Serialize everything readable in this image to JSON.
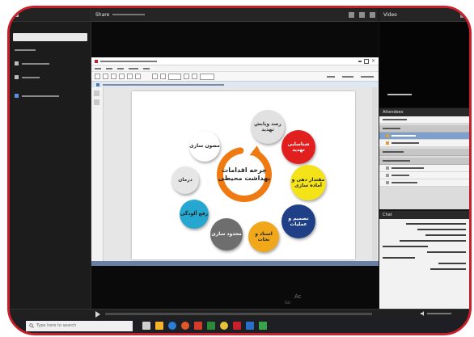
{
  "share_pod": {
    "title": "Share"
  },
  "video_pod": {
    "title": "Video"
  },
  "attendees_pod": {
    "title": "Attendees",
    "sections": [
      {
        "label": ""
      },
      {
        "label": ""
      },
      {
        "label": ""
      }
    ]
  },
  "chat_pod": {
    "title": "Chat"
  },
  "left_panel": {
    "items": [
      {
        "label": ""
      },
      {
        "label": ""
      },
      {
        "label": ""
      }
    ]
  },
  "diagram": {
    "center": "چرخه اقدامات بهداشت محیطی",
    "bubbles": [
      {
        "label": "رصد ویابش تهدید",
        "color": "#e1e1e1",
        "text_color": "#333333"
      },
      {
        "label": "شناسایی تهدید",
        "color": "#e21f1f",
        "text_color": "#ffffff"
      },
      {
        "label": "مقتدار دهی و آماده سازی",
        "color": "#f5e31a",
        "text_color": "#222222"
      },
      {
        "label": "تصمیم و عملیات",
        "color": "#1f3f86",
        "text_color": "#ffffff"
      },
      {
        "label": "اسناد و نجات",
        "color": "#f0a71a",
        "text_color": "#222222"
      },
      {
        "label": "محدود سازی",
        "color": "#6e6e6e",
        "text_color": "#ffffff"
      },
      {
        "label": "رفع آلودگی",
        "color": "#26a7cf",
        "text_color": "#222222"
      },
      {
        "label": "درمان",
        "color": "#e6e6e6",
        "text_color": "#333333"
      },
      {
        "label": "مصون سازی",
        "color": "#ffffff",
        "text_color": "#222222"
      }
    ],
    "arrow_color": "#f07a12"
  },
  "taskbar": {
    "search_placeholder": "Type here to search"
  },
  "watermark": {
    "line1": "Ac",
    "line2": "Go"
  }
}
